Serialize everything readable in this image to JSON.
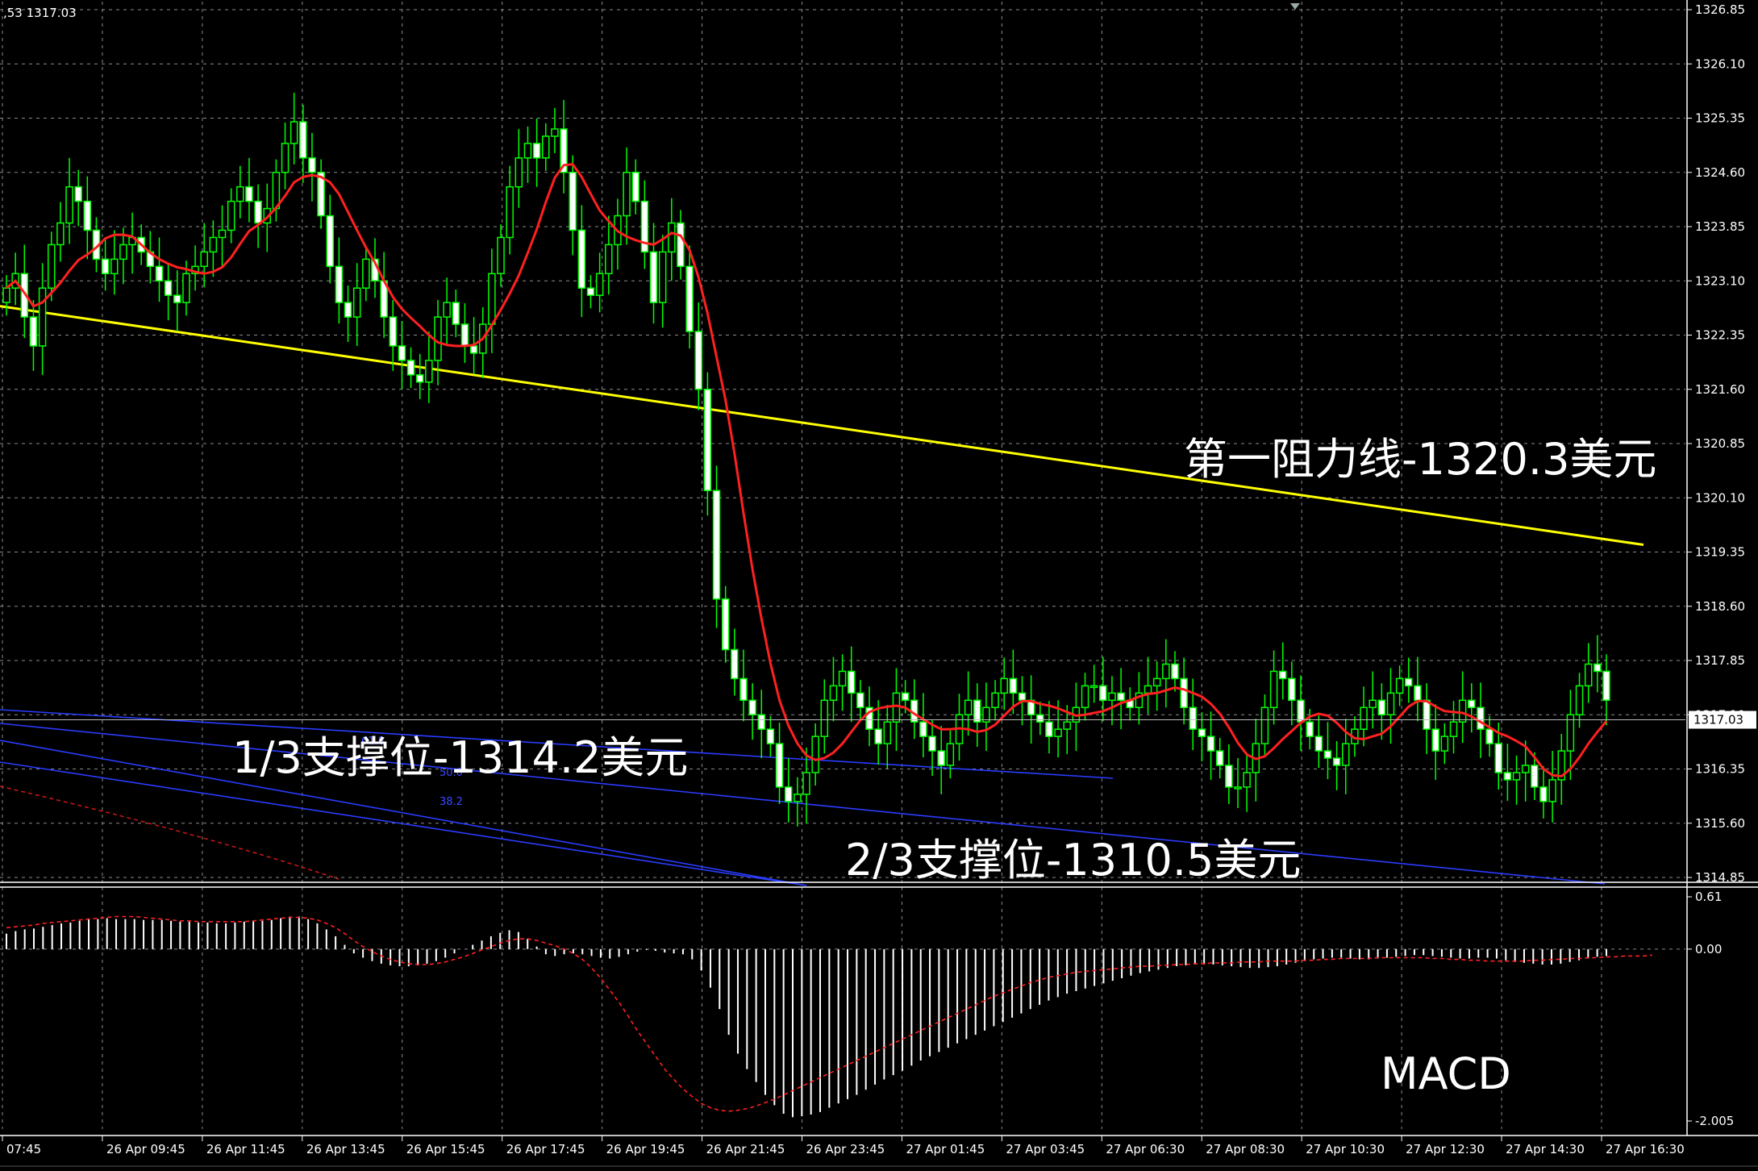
{
  "header": {
    "text": ",53 1317.03"
  },
  "colors": {
    "background": "#000000",
    "grid": "#8c8c8c",
    "bull_candle": "#00ff00",
    "bear_candle": "#ffffff",
    "ma_line": "#ff2020",
    "resistance_line": "#ffff00",
    "fib_lines": "#2a3cff",
    "macd_hist": "#ffffff",
    "macd_signal": "#ff2020"
  },
  "annotations": {
    "resistance_label": "第一阻力线-1320.3美元",
    "support1_label": "1/3支撑位-1314.2美元",
    "support2_label": "2/3支撑位-1310.5美元",
    "macd_label": "MACD"
  },
  "chart_data": [
    {
      "type": "candlestick",
      "title": "",
      "ylim": [
        1314.85,
        1326.85
      ],
      "price_ticks": [
        "1326.85",
        "1326.10",
        "1325.35",
        "1324.60",
        "1323.85",
        "1323.10",
        "1322.35",
        "1321.60",
        "1320.85",
        "1320.10",
        "1319.35",
        "1318.60",
        "1317.85",
        "1317.10",
        "1316.35",
        "1315.60",
        "1314.85"
      ],
      "current_price": "1317.03",
      "time_ticks": [
        "07:45",
        "26 Apr 09:45",
        "26 Apr 11:45",
        "26 Apr 13:45",
        "26 Apr 15:45",
        "26 Apr 17:45",
        "26 Apr 19:45",
        "26 Apr 21:45",
        "26 Apr 23:45",
        "27 Apr 01:45",
        "27 Apr 03:45",
        "27 Apr 06:30",
        "27 Apr 08:30",
        "27 Apr 10:30",
        "27 Apr 12:30",
        "27 Apr 14:30",
        "27 Apr 16:30"
      ],
      "close": [
        1323.0,
        1323.2,
        1322.6,
        1322.2,
        1323.0,
        1323.6,
        1323.9,
        1324.4,
        1324.2,
        1323.8,
        1323.4,
        1323.2,
        1323.4,
        1323.6,
        1323.7,
        1323.5,
        1323.3,
        1323.1,
        1322.9,
        1322.8,
        1323.2,
        1323.3,
        1323.5,
        1323.7,
        1323.8,
        1324.2,
        1324.4,
        1324.2,
        1323.9,
        1324.1,
        1324.6,
        1325.0,
        1325.3,
        1324.8,
        1324.6,
        1324.0,
        1323.3,
        1322.8,
        1322.6,
        1323.0,
        1323.4,
        1323.1,
        1322.6,
        1322.2,
        1322.0,
        1321.8,
        1321.7,
        1322.0,
        1322.6,
        1322.8,
        1322.5,
        1322.2,
        1322.1,
        1322.5,
        1323.2,
        1323.7,
        1324.4,
        1324.8,
        1325.0,
        1324.8,
        1325.1,
        1325.2,
        1324.6,
        1323.8,
        1323.0,
        1322.9,
        1323.2,
        1323.6,
        1324.0,
        1324.6,
        1324.2,
        1323.5,
        1322.8,
        1323.5,
        1323.9,
        1323.3,
        1322.4,
        1321.6,
        1320.2,
        1318.7,
        1318.0,
        1317.6,
        1317.3,
        1317.1,
        1316.9,
        1316.7,
        1316.1,
        1315.9,
        1316.0,
        1316.3,
        1316.8,
        1317.3,
        1317.5,
        1317.7,
        1317.4,
        1317.2,
        1316.9,
        1316.7,
        1317.0,
        1317.4,
        1317.3,
        1317.0,
        1316.8,
        1316.6,
        1316.4,
        1316.7,
        1317.1,
        1317.3,
        1317.0,
        1317.2,
        1317.4,
        1317.6,
        1317.4,
        1317.3,
        1317.1,
        1317.0,
        1316.8,
        1316.9,
        1317.0,
        1317.2,
        1317.5,
        1317.5,
        1317.3,
        1317.4,
        1317.3,
        1317.2,
        1317.4,
        1317.5,
        1317.6,
        1317.8,
        1317.6,
        1317.2,
        1316.9,
        1316.8,
        1316.6,
        1316.4,
        1316.1,
        1316.1,
        1316.3,
        1316.7,
        1317.2,
        1317.7,
        1317.6,
        1317.3,
        1317.0,
        1316.8,
        1316.6,
        1316.5,
        1316.4,
        1316.7,
        1316.9,
        1317.2,
        1317.3,
        1317.1,
        1317.4,
        1317.6,
        1317.5,
        1317.3,
        1316.9,
        1316.6,
        1316.8,
        1317.0,
        1317.3,
        1317.2,
        1316.9,
        1316.7,
        1316.3,
        1316.2,
        1316.3,
        1316.4,
        1316.1,
        1315.9,
        1316.2,
        1316.6,
        1317.1,
        1317.5,
        1317.8,
        1317.7,
        1317.3
      ]
    },
    {
      "type": "bar",
      "title": "MACD",
      "ylim": [
        -2.005,
        0.61
      ],
      "ticks": [
        "0.61",
        "0.00",
        "-2.005"
      ],
      "hist": [
        0.18,
        0.21,
        0.23,
        0.24,
        0.26,
        0.28,
        0.3,
        0.31,
        0.33,
        0.35,
        0.35,
        0.36,
        0.35,
        0.35,
        0.35,
        0.34,
        0.34,
        0.34,
        0.33,
        0.32,
        0.32,
        0.31,
        0.31,
        0.3,
        0.3,
        0.31,
        0.32,
        0.33,
        0.33,
        0.34,
        0.36,
        0.38,
        0.38,
        0.35,
        0.3,
        0.23,
        0.15,
        0.05,
        -0.05,
        -0.1,
        -0.14,
        -0.17,
        -0.19,
        -0.2,
        -0.2,
        -0.19,
        -0.17,
        -0.14,
        -0.1,
        -0.05,
        0.0,
        0.05,
        0.1,
        0.15,
        0.19,
        0.22,
        0.2,
        0.12,
        0.03,
        -0.06,
        -0.08,
        -0.06,
        -0.05,
        -0.06,
        -0.08,
        -0.1,
        -0.11,
        -0.09,
        -0.06,
        -0.03,
        -0.01,
        -0.02,
        -0.04,
        -0.05,
        -0.06,
        -0.12,
        -0.25,
        -0.45,
        -0.7,
        -1.0,
        -1.22,
        -1.4,
        -1.55,
        -1.7,
        -1.82,
        -1.92,
        -1.96,
        -1.95,
        -1.93,
        -1.9,
        -1.85,
        -1.8,
        -1.75,
        -1.7,
        -1.64,
        -1.58,
        -1.52,
        -1.47,
        -1.42,
        -1.36,
        -1.3,
        -1.25,
        -1.2,
        -1.15,
        -1.1,
        -1.05,
        -1.0,
        -0.95,
        -0.9,
        -0.85,
        -0.8,
        -0.75,
        -0.7,
        -0.65,
        -0.6,
        -0.56,
        -0.52,
        -0.49,
        -0.46,
        -0.43,
        -0.4,
        -0.37,
        -0.34,
        -0.31,
        -0.28,
        -0.26,
        -0.24,
        -0.22,
        -0.2,
        -0.19,
        -0.18,
        -0.18,
        -0.18,
        -0.19,
        -0.2,
        -0.21,
        -0.22,
        -0.22,
        -0.21,
        -0.2,
        -0.18,
        -0.16,
        -0.14,
        -0.12,
        -0.11,
        -0.1,
        -0.1,
        -0.11,
        -0.12,
        -0.12,
        -0.11,
        -0.1,
        -0.09,
        -0.08,
        -0.07,
        -0.07,
        -0.08,
        -0.09,
        -0.1,
        -0.11,
        -0.11,
        -0.1,
        -0.1,
        -0.11,
        -0.13,
        -0.15,
        -0.16,
        -0.17,
        -0.18,
        -0.18,
        -0.17,
        -0.15,
        -0.13,
        -0.11,
        -0.09,
        -0.08
      ],
      "signal": [
        0.25,
        0.26,
        0.27,
        0.28,
        0.3,
        0.31,
        0.32,
        0.33,
        0.34,
        0.35,
        0.36,
        0.37,
        0.38,
        0.38,
        0.38,
        0.37,
        0.36,
        0.35,
        0.34,
        0.33,
        0.33,
        0.32,
        0.32,
        0.32,
        0.32,
        0.32,
        0.32,
        0.33,
        0.34,
        0.35,
        0.36,
        0.37,
        0.37,
        0.36,
        0.34,
        0.3,
        0.25,
        0.18,
        0.1,
        0.03,
        -0.03,
        -0.08,
        -0.12,
        -0.15,
        -0.17,
        -0.18,
        -0.18,
        -0.17,
        -0.15,
        -0.12,
        -0.09,
        -0.05,
        -0.01,
        0.03,
        0.07,
        0.1,
        0.12,
        0.12,
        0.1,
        0.07,
        0.04,
        0.0,
        -0.05,
        -0.12,
        -0.22,
        -0.34,
        -0.48,
        -0.62,
        -0.78,
        -0.95,
        -1.1,
        -1.25,
        -1.4,
        -1.52,
        -1.63,
        -1.72,
        -1.8,
        -1.85,
        -1.88,
        -1.89,
        -1.88,
        -1.86,
        -1.83,
        -1.79,
        -1.75,
        -1.7,
        -1.65,
        -1.6,
        -1.55,
        -1.5,
        -1.45,
        -1.4,
        -1.35,
        -1.3,
        -1.25,
        -1.2,
        -1.15,
        -1.1,
        -1.05,
        -1.0,
        -0.95,
        -0.9,
        -0.85,
        -0.8,
        -0.75,
        -0.7,
        -0.65,
        -0.6,
        -0.55,
        -0.51,
        -0.47,
        -0.43,
        -0.39,
        -0.36,
        -0.33,
        -0.31,
        -0.29,
        -0.27,
        -0.26,
        -0.25,
        -0.24,
        -0.23,
        -0.22,
        -0.21,
        -0.2,
        -0.2,
        -0.19,
        -0.19,
        -0.18,
        -0.18,
        -0.17,
        -0.17,
        -0.16,
        -0.16,
        -0.16,
        -0.15,
        -0.15,
        -0.15,
        -0.14,
        -0.14,
        -0.14,
        -0.14,
        -0.13,
        -0.13,
        -0.12,
        -0.12,
        -0.11,
        -0.11,
        -0.11,
        -0.11,
        -0.1,
        -0.1,
        -0.1,
        -0.1,
        -0.1,
        -0.1,
        -0.11,
        -0.11,
        -0.12,
        -0.12,
        -0.13,
        -0.13,
        -0.14,
        -0.14,
        -0.14,
        -0.14,
        -0.14,
        -0.13,
        -0.13,
        -0.12,
        -0.12,
        -0.11,
        -0.11,
        -0.1,
        -0.1,
        -0.09,
        -0.09,
        -0.08,
        -0.08,
        -0.08,
        -0.07
      ]
    }
  ]
}
